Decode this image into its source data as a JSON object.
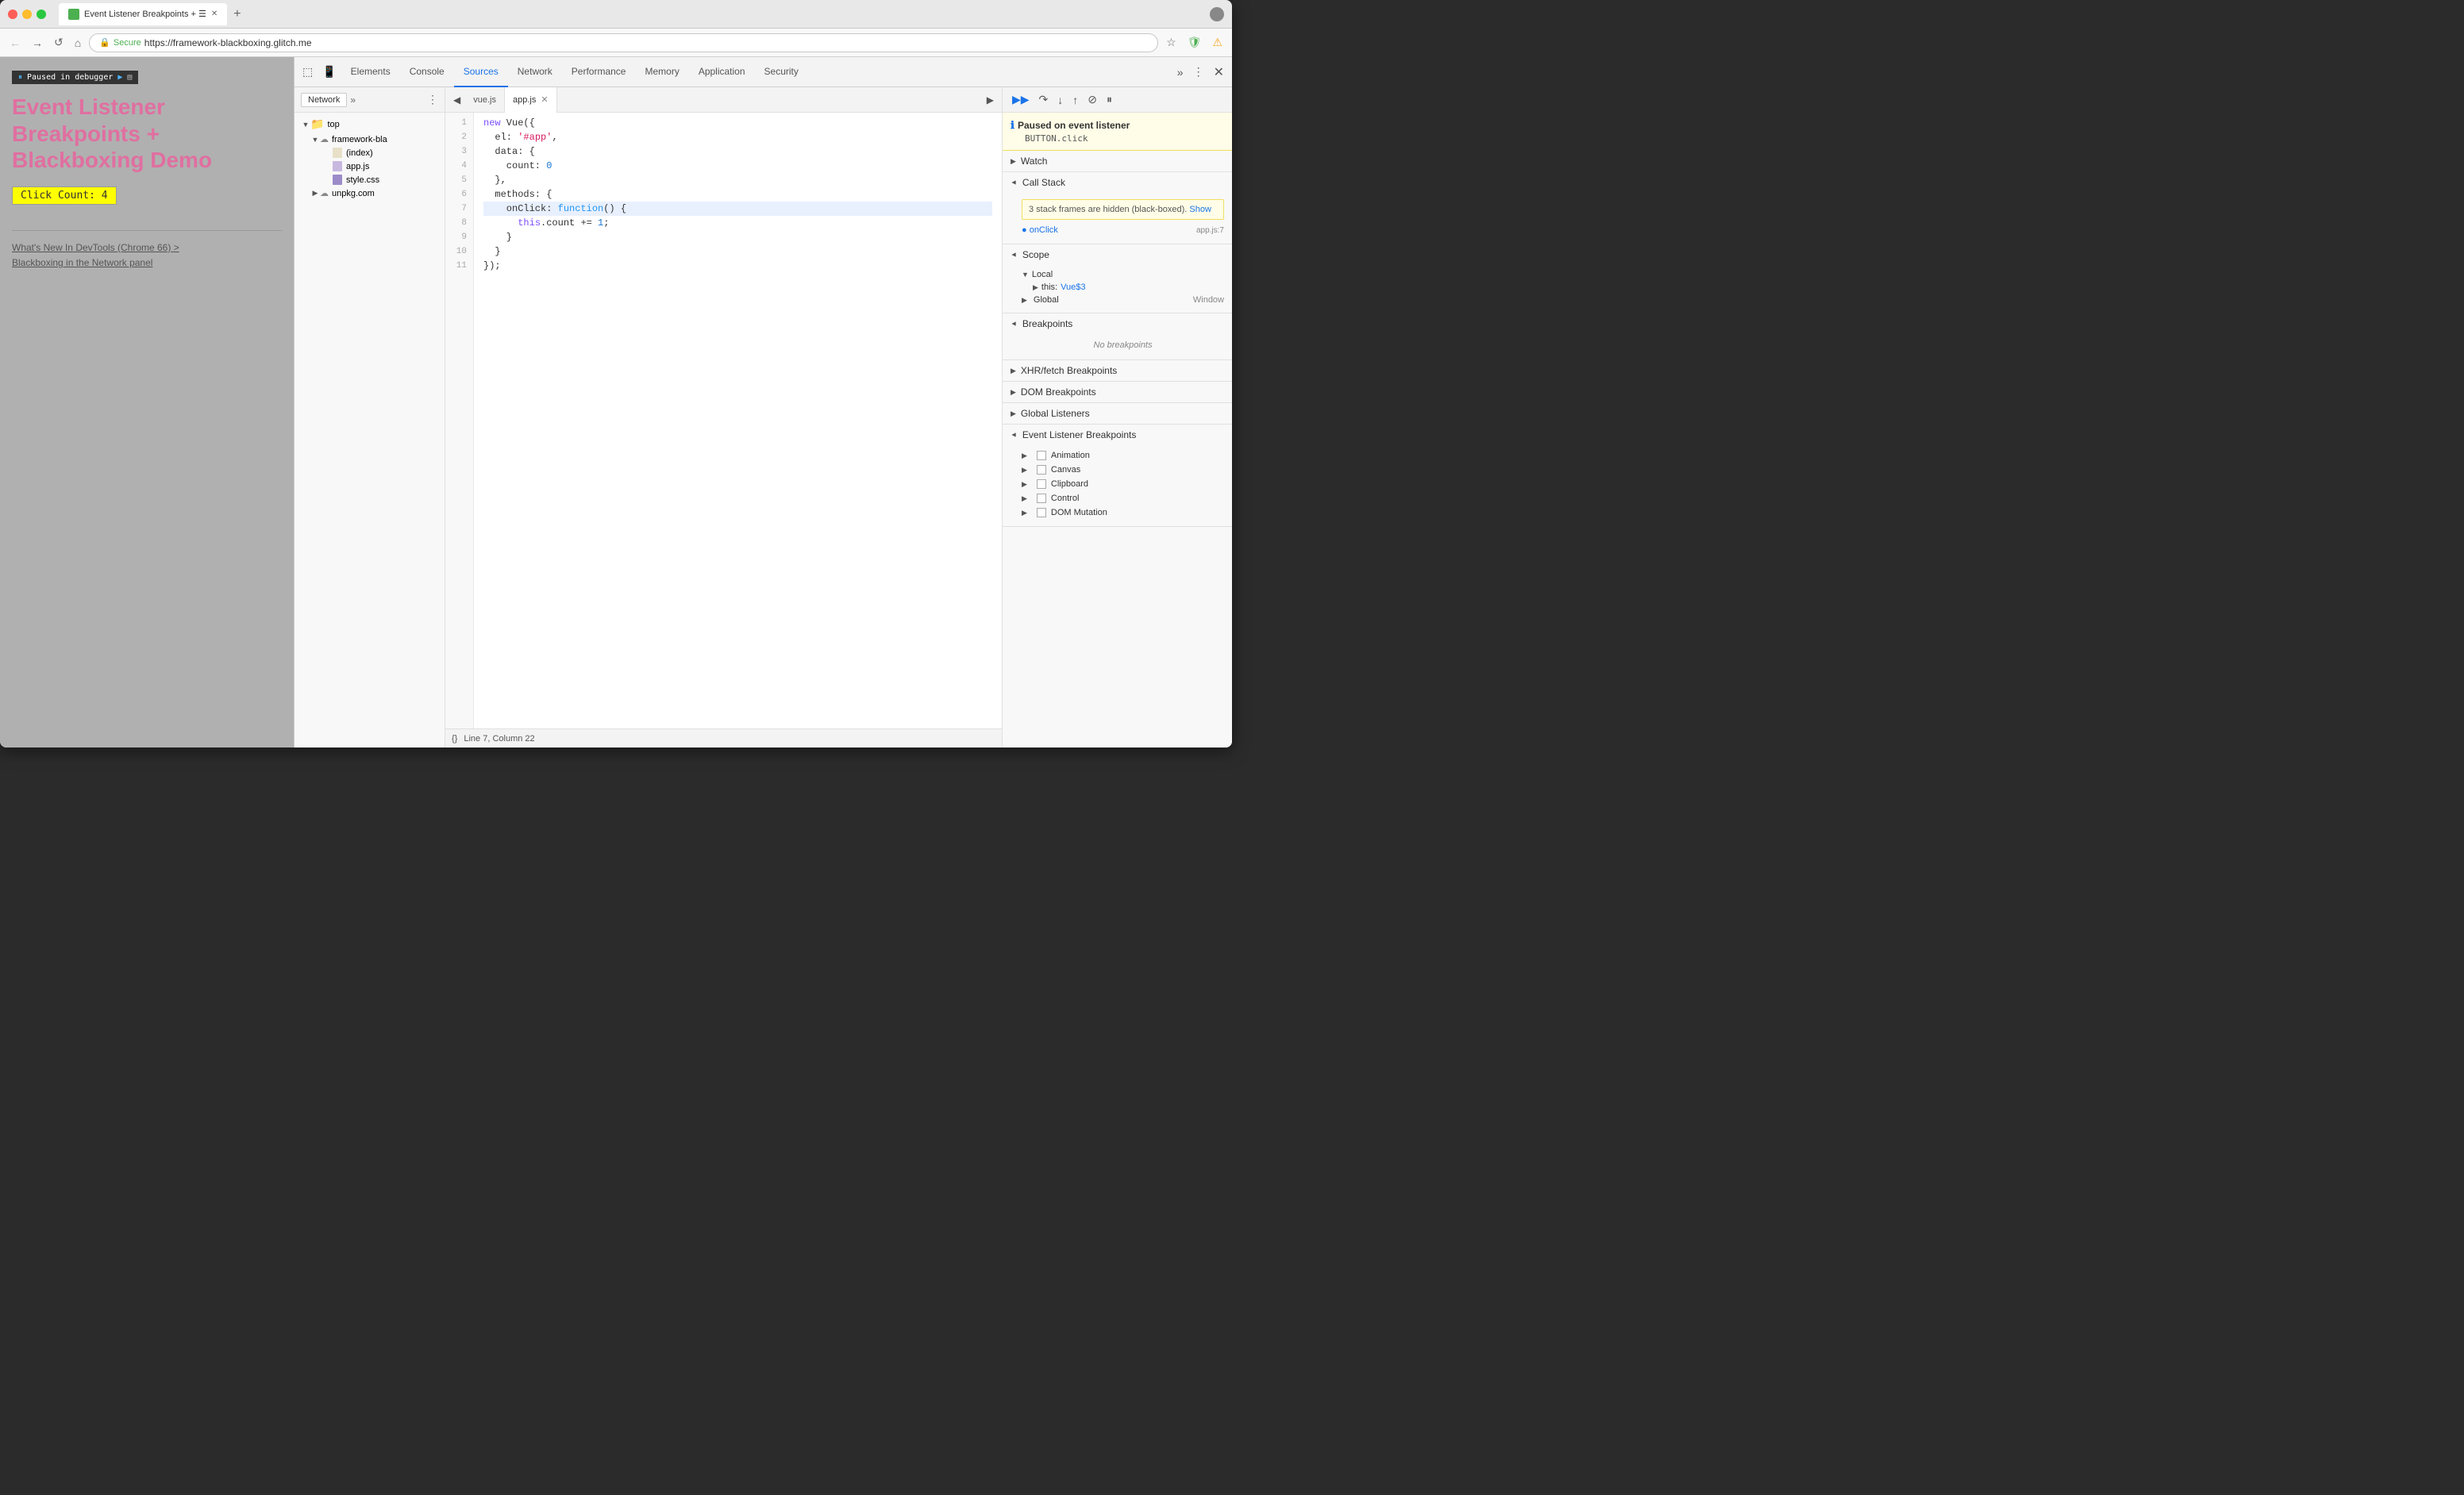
{
  "browser": {
    "tab_title": "Event Listener Breakpoints + ☰",
    "url_secure_text": "Secure",
    "url": "https://framework-blackboxing.glitch.me",
    "traffic_lights": [
      "red",
      "yellow",
      "green"
    ]
  },
  "page": {
    "paused_banner": "Paused in debugger",
    "title": "Event Listener Breakpoints + Blackboxing Demo",
    "click_count_btn": "Click Count: 4",
    "link1": "What's New In DevTools (Chrome 66) >",
    "link2": "Blackboxing in the Network panel"
  },
  "devtools": {
    "tabs": [
      "Elements",
      "Console",
      "Sources",
      "Network",
      "Performance",
      "Memory",
      "Application",
      "Security"
    ],
    "active_tab": "Sources"
  },
  "sources_sidebar": {
    "network_tab": "Network",
    "tree": [
      {
        "type": "folder",
        "name": "top",
        "level": 0,
        "expanded": true,
        "arrow": "▼"
      },
      {
        "type": "folder_cloud",
        "name": "framework-bla",
        "level": 1,
        "expanded": true,
        "arrow": "▼"
      },
      {
        "type": "file_html",
        "name": "(index)",
        "level": 2
      },
      {
        "type": "file_js",
        "name": "app.js",
        "level": 2
      },
      {
        "type": "file_css",
        "name": "style.css",
        "level": 2
      },
      {
        "type": "folder_cloud",
        "name": "unpkg.com",
        "level": 1,
        "expanded": false,
        "arrow": "▶"
      }
    ]
  },
  "editor": {
    "tabs": [
      {
        "name": "vue.js",
        "active": false
      },
      {
        "name": "app.js",
        "active": true
      }
    ],
    "file_name": "app.js",
    "lines": [
      {
        "num": 1,
        "code": "new Vue({",
        "highlighted": false
      },
      {
        "num": 2,
        "code": "  el: '#app',",
        "highlighted": false
      },
      {
        "num": 3,
        "code": "  data: {",
        "highlighted": false
      },
      {
        "num": 4,
        "code": "    count: 0",
        "highlighted": false
      },
      {
        "num": 5,
        "code": "  },",
        "highlighted": false
      },
      {
        "num": 6,
        "code": "  methods: {",
        "highlighted": false
      },
      {
        "num": 7,
        "code": "    onClick: function() {",
        "highlighted": true
      },
      {
        "num": 8,
        "code": "      this.count += 1;",
        "highlighted": false
      },
      {
        "num": 9,
        "code": "    }",
        "highlighted": false
      },
      {
        "num": 10,
        "code": "  }",
        "highlighted": false
      },
      {
        "num": 11,
        "code": "});",
        "highlighted": false
      }
    ],
    "status": "Line 7, Column 22"
  },
  "debugger": {
    "paused_title": "Paused on event listener",
    "paused_subtitle": "BUTTON.click",
    "toolbar_btns": [
      "resume",
      "step-over",
      "step-into",
      "step-out",
      "deactivate",
      "pause-exceptions"
    ],
    "sections": {
      "watch": {
        "label": "Watch",
        "expanded": false
      },
      "call_stack": {
        "label": "Call Stack",
        "expanded": true,
        "warning": "3 stack frames are hidden (black-boxed).",
        "show_link": "Show",
        "items": [
          {
            "name": "onClick",
            "file": "app.js:7"
          }
        ]
      },
      "scope": {
        "label": "Scope",
        "expanded": true,
        "local": {
          "label": "Local",
          "items": [
            {
              "key": "this",
              "value": "Vue$3",
              "expanded": false
            }
          ]
        },
        "global": {
          "label": "Global",
          "value": "Window"
        }
      },
      "breakpoints": {
        "label": "Breakpoints",
        "expanded": true,
        "empty_text": "No breakpoints"
      },
      "xhr_breakpoints": {
        "label": "XHR/fetch Breakpoints",
        "expanded": false
      },
      "dom_breakpoints": {
        "label": "DOM Breakpoints",
        "expanded": false
      },
      "global_listeners": {
        "label": "Global Listeners",
        "expanded": false
      },
      "event_listener_breakpoints": {
        "label": "Event Listener Breakpoints",
        "expanded": true,
        "items": [
          {
            "name": "Animation",
            "expanded": false
          },
          {
            "name": "Canvas",
            "expanded": false
          },
          {
            "name": "Clipboard",
            "expanded": false
          },
          {
            "name": "Control",
            "expanded": false
          },
          {
            "name": "DOM Mutation",
            "expanded": false
          }
        ]
      }
    }
  }
}
